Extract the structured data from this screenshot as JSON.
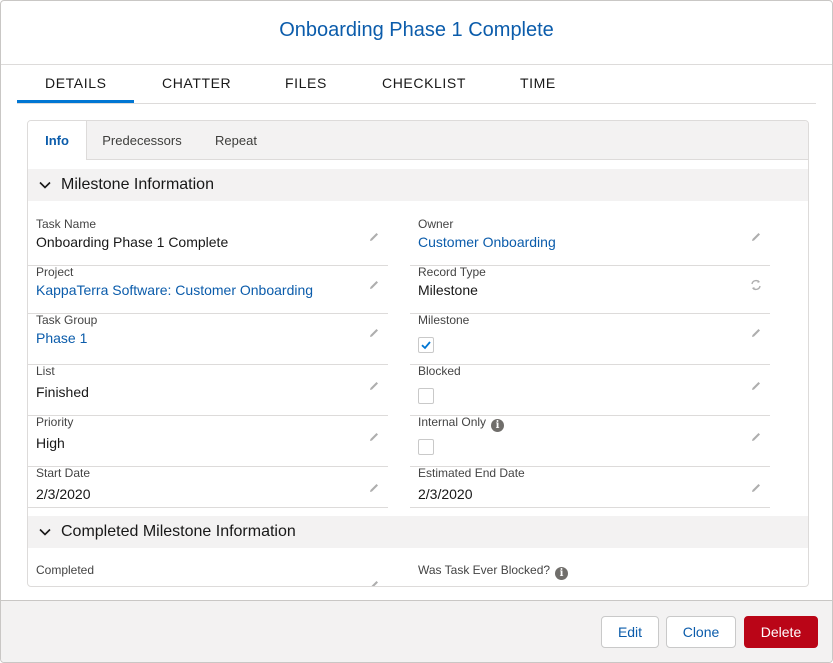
{
  "modal": {
    "title": "Onboarding Phase 1 Complete"
  },
  "tabs": [
    {
      "label": "DETAILS",
      "active": true
    },
    {
      "label": "CHATTER",
      "active": false
    },
    {
      "label": "FILES",
      "active": false
    },
    {
      "label": "CHECKLIST",
      "active": false
    },
    {
      "label": "TIME",
      "active": false
    }
  ],
  "subtabs": [
    {
      "label": "Info",
      "active": true
    },
    {
      "label": "Predecessors",
      "active": false
    },
    {
      "label": "Repeat",
      "active": false
    }
  ],
  "sections": {
    "milestone": {
      "title": "Milestone Information",
      "left": [
        {
          "label": "Task Name",
          "value": "Onboarding Phase 1 Complete",
          "link": false
        },
        {
          "label": "Project",
          "value": "KappaTerra Software: Customer Onboarding",
          "link": true
        },
        {
          "label": "Task Group",
          "value": "Phase 1",
          "link": true
        },
        {
          "label": "List",
          "value": "Finished",
          "link": false
        },
        {
          "label": "Priority",
          "value": "High",
          "link": false
        },
        {
          "label": "Start Date",
          "value": "2/3/2020",
          "link": false
        }
      ],
      "right": [
        {
          "label": "Owner",
          "value": "Customer Onboarding",
          "link": true
        },
        {
          "label": "Record Type",
          "value": "Milestone",
          "link": false
        },
        {
          "label": "Milestone",
          "checked": true
        },
        {
          "label": "Blocked",
          "checked": false
        },
        {
          "label": "Internal Only",
          "checked": false
        },
        {
          "label": "Estimated End Date",
          "value": "2/3/2020",
          "link": false
        }
      ]
    },
    "completed": {
      "title": "Completed Milestone Information",
      "left_label": "Completed",
      "right_label": "Was Task Ever Blocked?"
    }
  },
  "footer": {
    "edit_label": "Edit",
    "clone_label": "Clone",
    "delete_label": "Delete"
  },
  "colors": {
    "accent": "#0176d3",
    "link": "#0b5cab",
    "destructive": "#ba0517"
  }
}
